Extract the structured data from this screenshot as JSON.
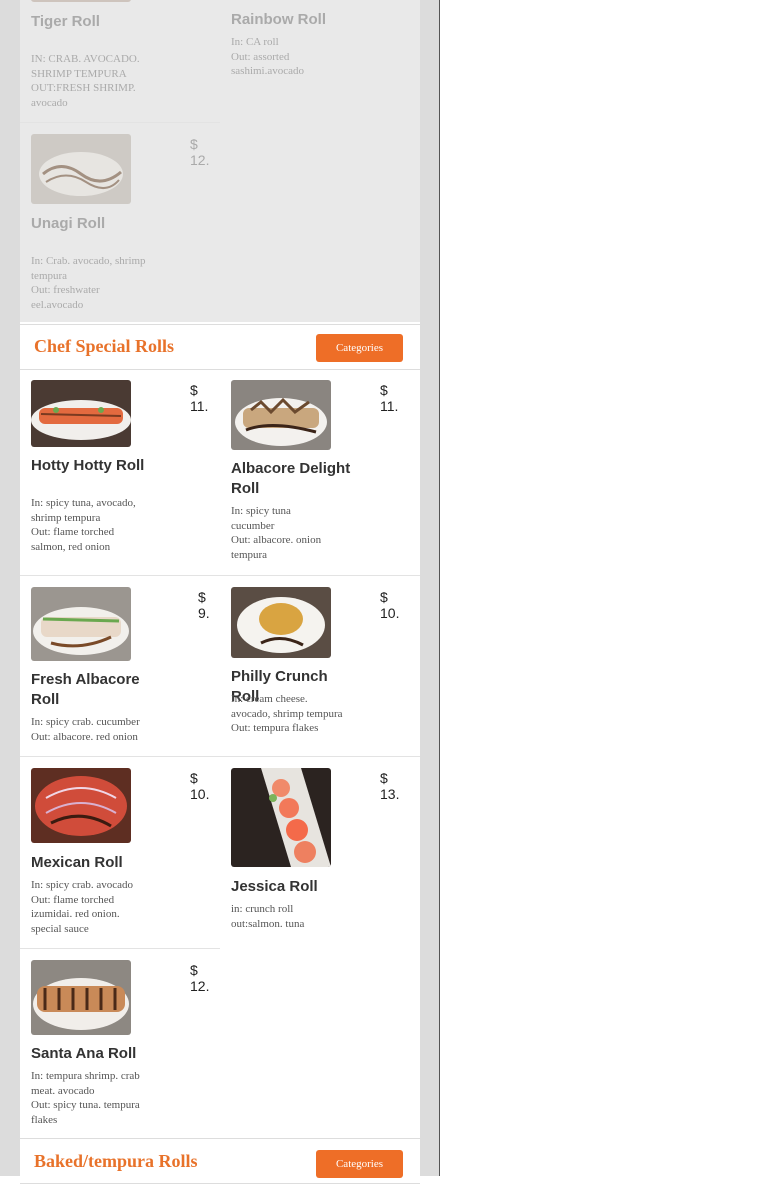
{
  "top_items": [
    {
      "name": "Tiger Roll",
      "desc": "IN: CRAB. AVOCADO.\nSHRIMP TEMPURA\nOUT:FRESH SHRIMP.\navocado"
    },
    {
      "name": "Rainbow Roll",
      "desc": "In: CA roll\nOut: assorted\nsashimi.avocado"
    },
    {
      "name": "Unagi Roll",
      "price": "$ 12.",
      "desc": "In: Crab. avocado, shrimp\ntempura\nOut: freshwater\neel.avocado"
    }
  ],
  "chef_section": {
    "title": "Chef Special Rolls",
    "button": "Categories",
    "items": [
      {
        "name": "Hotty Hotty Roll",
        "price": "$ 11.",
        "desc": "In: spicy tuna, avocado,\nshrimp tempura\nOut: flame torched\nsalmon, red onion"
      },
      {
        "name": "Albacore Delight Roll",
        "price": "$ 11.",
        "desc": "In: spicy tuna\ncucumber\nOut: albacore. onion\ntempura"
      },
      {
        "name": "Fresh Albacore Roll",
        "price": "$ 9.",
        "desc": "In: spicy crab. cucumber\nOut: albacore. red onion"
      },
      {
        "name": "Philly Crunch Roll",
        "price": "$ 10.",
        "desc": "In: cream cheese.\navocado, shrimp tempura\nOut: tempura flakes"
      },
      {
        "name": "Mexican Roll",
        "price": "$ 10.",
        "desc": "In: spicy crab. avocado\nOut: flame torched\nizumidai. red onion.\nspecial sauce"
      },
      {
        "name": "Jessica Roll",
        "price": "$ 13.",
        "desc": "in: crunch roll\nout:salmon. tuna"
      },
      {
        "name": "Santa Ana Roll",
        "price": "$ 12.",
        "desc": "In: tempura shrimp. crab\nmeat. avocado\nOut: spicy tuna. tempura\nflakes"
      }
    ]
  },
  "baked_section": {
    "title": "Baked/tempura Rolls",
    "button": "Categories"
  }
}
